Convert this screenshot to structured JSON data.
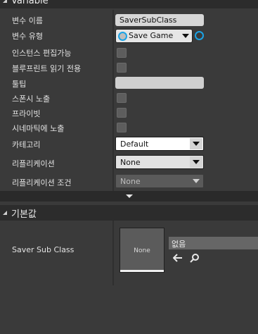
{
  "variable_section": {
    "title": "Variable"
  },
  "rows": {
    "variable_name": {
      "label": "변수 이름",
      "value": "SaverSubClass"
    },
    "variable_type": {
      "label": "변수 유형",
      "value": "Save Game"
    },
    "instance_editable": {
      "label": "인스턴스 편집가능"
    },
    "blueprint_read_only": {
      "label": "블루프린트 읽기 전용"
    },
    "tooltip": {
      "label": "툴팁",
      "value": ""
    },
    "expose_on_spawn": {
      "label": "스폰시 노출"
    },
    "private": {
      "label": "프라이빗"
    },
    "expose_to_cinematics": {
      "label": "시네마틱에 노출"
    },
    "category": {
      "label": "카테고리",
      "value": "Default"
    },
    "replication": {
      "label": "리플리케이션",
      "value": "None"
    },
    "replication_condition": {
      "label": "리플리케이션 조건",
      "value": "None"
    }
  },
  "default_value_section": {
    "title": "기본값"
  },
  "default_value": {
    "label": "Saver Sub Class",
    "thumbnail_text": "None",
    "asset_value": "없음"
  },
  "colors": {
    "pin": "#1aa3e6",
    "panel": "#3a3a3a",
    "header": "#2c2c2c"
  },
  "icons": [
    "arrow-left-icon",
    "search-icon",
    "chevron-down-icon",
    "collapse-triangle-icon"
  ]
}
